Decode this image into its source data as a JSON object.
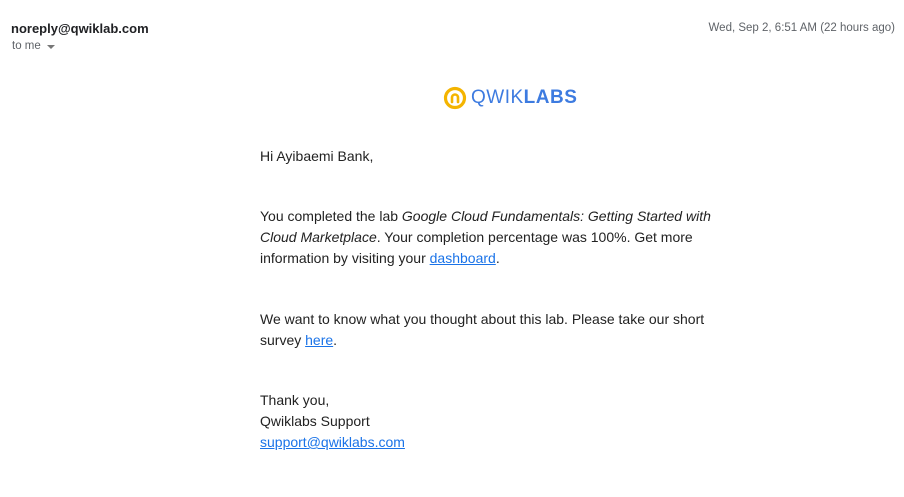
{
  "email": {
    "sender": "noreply@qwiklab.com",
    "recipient": "to me",
    "date": "Wed, Sep 2, 6:51 AM (22 hours ago)"
  },
  "logo": {
    "part1": "QWIK",
    "part2": "LABS",
    "accent_color": "#f4b400",
    "brand_color": "#3d7be0"
  },
  "body": {
    "greeting": "Hi Ayibaemi Bank,",
    "p1_prefix": "You completed the lab ",
    "p1_lab_name": "Google Cloud Fundamentals: Getting Started with Cloud Marketplace",
    "p1_suffix": ". Your completion percentage was 100%. Get more information by visiting your ",
    "p1_link": "dashboard",
    "p1_end": ".",
    "p2_prefix": "We want to know what you thought about this lab. Please take our short survey ",
    "p2_link": "here",
    "p2_end": ".",
    "closing": "Thank you,",
    "signature": "Qwiklabs Support",
    "support_email": "support@qwiklabs.com"
  }
}
